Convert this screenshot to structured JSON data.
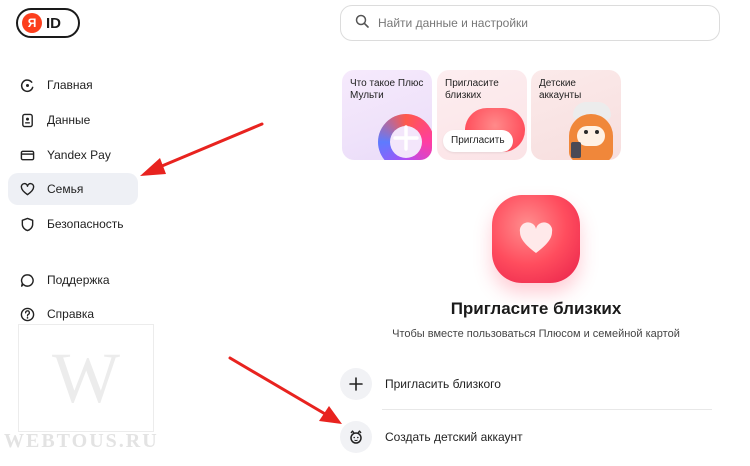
{
  "logo": {
    "ya": "Я",
    "id": "ID"
  },
  "search": {
    "placeholder": "Найти данные и настройки"
  },
  "sidebar": {
    "items": [
      {
        "label": "Главная",
        "icon": "home-icon"
      },
      {
        "label": "Данные",
        "icon": "data-icon"
      },
      {
        "label": "Yandex Pay",
        "icon": "card-icon"
      },
      {
        "label": "Семья",
        "icon": "heart-icon",
        "active": true
      },
      {
        "label": "Безопасность",
        "icon": "shield-icon"
      },
      {
        "label": "Поддержка",
        "icon": "chat-icon"
      },
      {
        "label": "Справка",
        "icon": "help-icon"
      }
    ]
  },
  "stories": [
    {
      "title": "Что такое Плюс Мульти"
    },
    {
      "title": "Пригласите близких",
      "button": "Пригласить"
    },
    {
      "title": "Детские аккаунты"
    }
  ],
  "family": {
    "title": "Пригласите близких",
    "subtitle": "Чтобы вместе пользоваться Плюсом и семейной картой",
    "actions": [
      {
        "label": "Пригласить близкого",
        "icon": "plus-icon"
      },
      {
        "label": "Создать детский аккаунт",
        "icon": "child-icon"
      }
    ]
  },
  "watermark": {
    "letter": "W",
    "text": "WEBTOUS.RU"
  },
  "colors": {
    "accent": "#fc3f1d",
    "arrow": "#e8231f",
    "active_bg": "#eef0f5",
    "heart": "#ff4d5e"
  }
}
